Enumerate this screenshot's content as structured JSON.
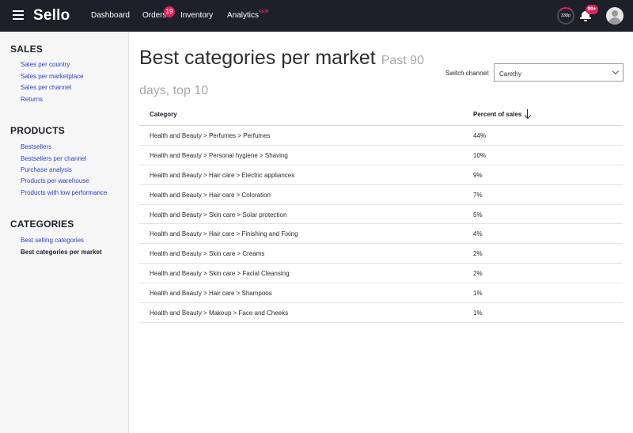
{
  "topbar": {
    "logo": "Sello",
    "nav": {
      "dashboard": "Dashboard",
      "orders": "Orders",
      "orders_badge": "19",
      "inventory": "Inventory",
      "analytics": "Analytics",
      "analytics_tag": "NEW"
    },
    "credit": "338p",
    "notifications_badge": "99+",
    "accent_color": "#e0245e",
    "background_color": "#1e2029"
  },
  "sidebar": {
    "sections": [
      {
        "heading": "SALES",
        "links": [
          "Sales per country",
          "Sales per marketplace",
          "Sales per channel",
          "Returns"
        ]
      },
      {
        "heading": "PRODUCTS",
        "links": [
          "Bestsellers",
          "Bestsellers per channel",
          "Purchase analysis",
          "Products per warehouse",
          "Products with low performance"
        ]
      },
      {
        "heading": "CATEGORIES",
        "links": [
          "Best selling categories",
          "Best categories per market"
        ]
      }
    ],
    "active_link": "Best categories per market",
    "link_color": "#2d3fd4"
  },
  "main": {
    "title": "Best categories per market",
    "subtitle": "Past 90 days, top 10",
    "switch_label": "Switch channel:",
    "channel_value": "Carethy",
    "table": {
      "headers": {
        "category": "Category",
        "percent": "Percent of sales"
      },
      "sort": "descending",
      "rows": [
        {
          "category": "Health and Beauty > Perfumes > Perfumes",
          "percent": "44%"
        },
        {
          "category": "Health and Beauty > Personal hygiene > Shaving",
          "percent": "10%"
        },
        {
          "category": "Health and Beauty > Hair care > Electric appliances",
          "percent": "9%"
        },
        {
          "category": "Health and Beauty > Hair care > Coloration",
          "percent": "7%"
        },
        {
          "category": "Health and Beauty > Skin care > Solar protection",
          "percent": "5%"
        },
        {
          "category": "Health and Beauty > Hair care > Finishing and Fixing",
          "percent": "4%"
        },
        {
          "category": "Health and Beauty > Skin care > Creams",
          "percent": "2%"
        },
        {
          "category": "Health and Beauty > Skin care > Facial Cleansing",
          "percent": "2%"
        },
        {
          "category": "Health and Beauty > Hair care > Shampoos",
          "percent": "1%"
        },
        {
          "category": "Health and Beauty > Makeup > Face and Cheeks",
          "percent": "1%"
        }
      ]
    }
  }
}
